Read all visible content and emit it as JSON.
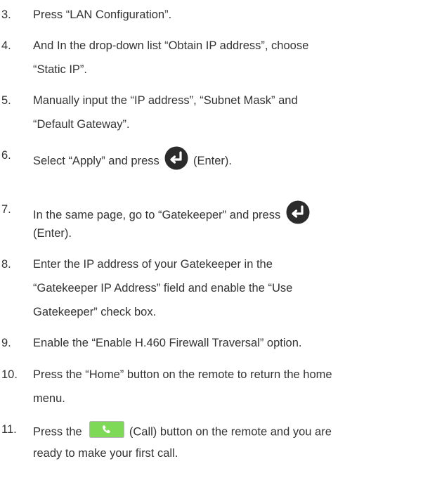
{
  "steps": [
    {
      "num": "3.",
      "lines": [
        "Press “LAN Configuration”."
      ]
    },
    {
      "num": "4.",
      "lines": [
        "And In the drop-down list “Obtain IP address”, choose",
        "“Static IP”."
      ]
    },
    {
      "num": "5.",
      "lines": [
        "Manually input the “IP address”, “Subnet Mask” and",
        "“Default Gateway”."
      ]
    },
    {
      "num": "6.",
      "before": "Select “Apply” and press",
      "after": "(Enter)."
    },
    {
      "num": "7.",
      "before": "In the same page, go to “Gatekeeper” and press",
      "line2": "(Enter)."
    },
    {
      "num": "8.",
      "lines": [
        "Enter the IP address of your Gatekeeper in the",
        "“Gatekeeper IP Address” field and enable the “Use",
        "Gatekeeper” check box."
      ]
    },
    {
      "num": "9.",
      "lines": [
        "Enable the “Enable H.460 Firewall Traversal” option."
      ]
    },
    {
      "num": "10.",
      "lines": [
        "Press the “Home” button on the remote to return the home",
        "menu."
      ]
    },
    {
      "num": "11.",
      "before": "Press the",
      "after": "(Call) button on the remote and you are",
      "line2": "ready to make your first call."
    }
  ],
  "icons": {
    "enter": "enter-key-icon",
    "call": "call-button-icon"
  },
  "colors": {
    "enter_icon_bg": "#2b2b2b",
    "call_icon_bg": "#7ed957"
  }
}
